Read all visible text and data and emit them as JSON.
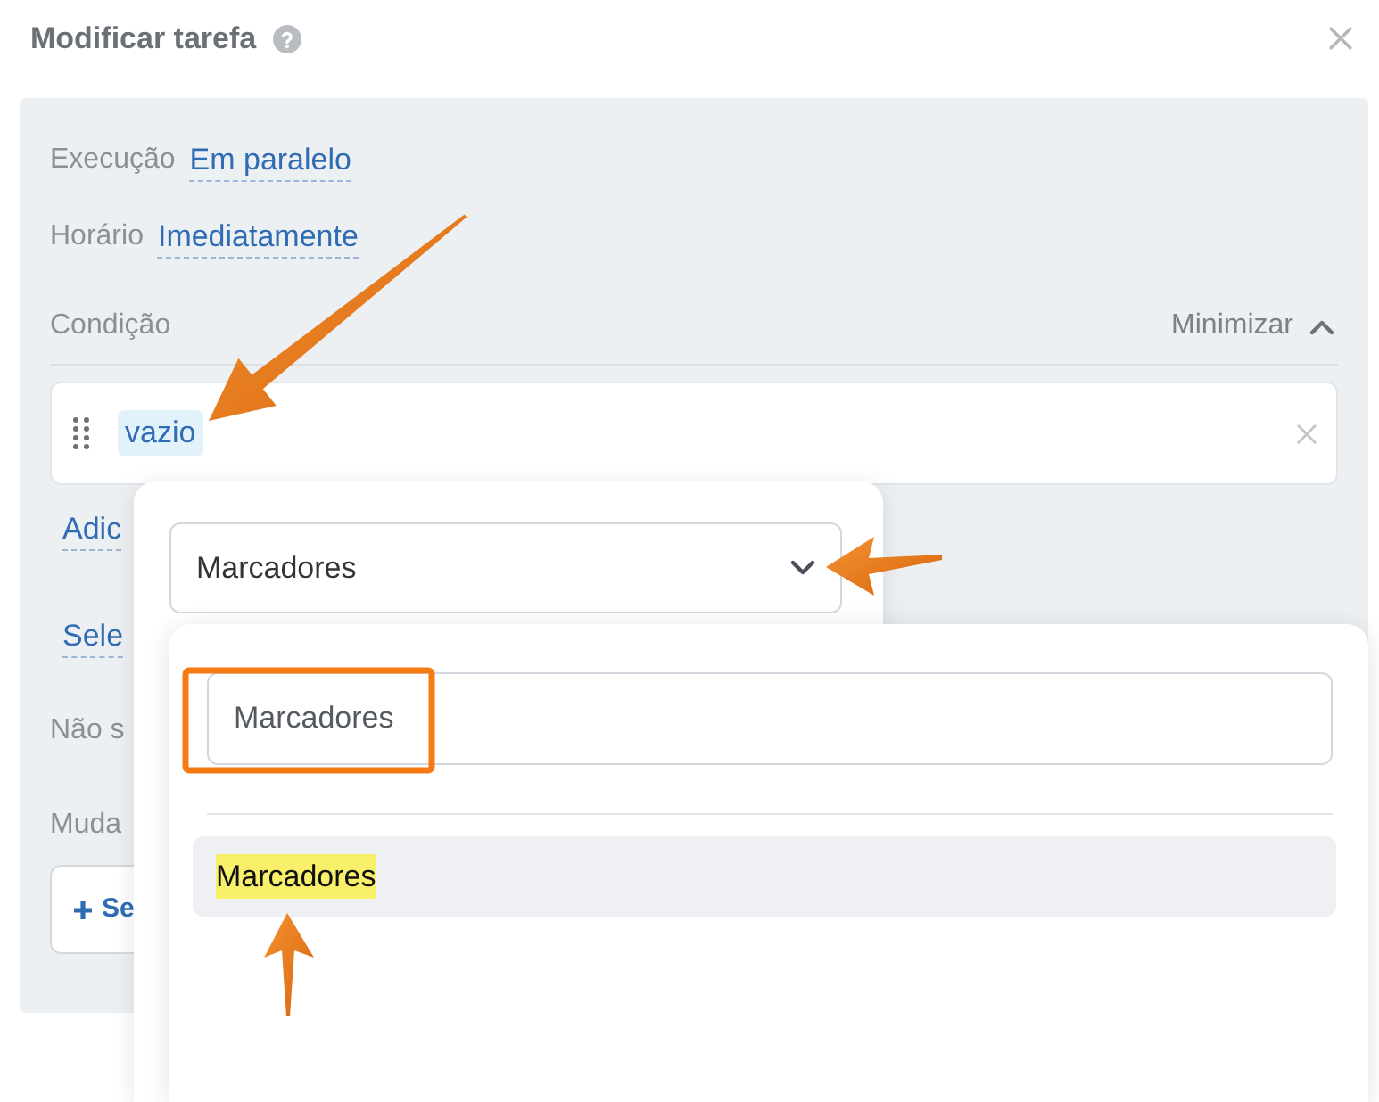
{
  "dialog": {
    "title": "Modificar tarefa"
  },
  "settings": [
    {
      "label": "Execução",
      "value": "Em paralelo"
    },
    {
      "label": "Horário",
      "value": "Imediatamente"
    }
  ],
  "condition": {
    "label": "Condição",
    "toggle": "Minimizar",
    "expanded": true,
    "tag": "vazio"
  },
  "rows": [
    {
      "kind": "link",
      "text": "Adic"
    },
    {
      "kind": "link",
      "text": "Sele"
    },
    {
      "kind": "label",
      "text": "Não s"
    },
    {
      "kind": "label",
      "text": "Muda"
    },
    {
      "kind": "button",
      "text": "Se"
    }
  ],
  "popover": {
    "select": {
      "value": "Marcadores"
    }
  },
  "dropdown": {
    "search": {
      "value": "Marcadores"
    },
    "options": [
      {
        "label": "Marcadores",
        "selected": true,
        "match": true
      }
    ]
  }
}
